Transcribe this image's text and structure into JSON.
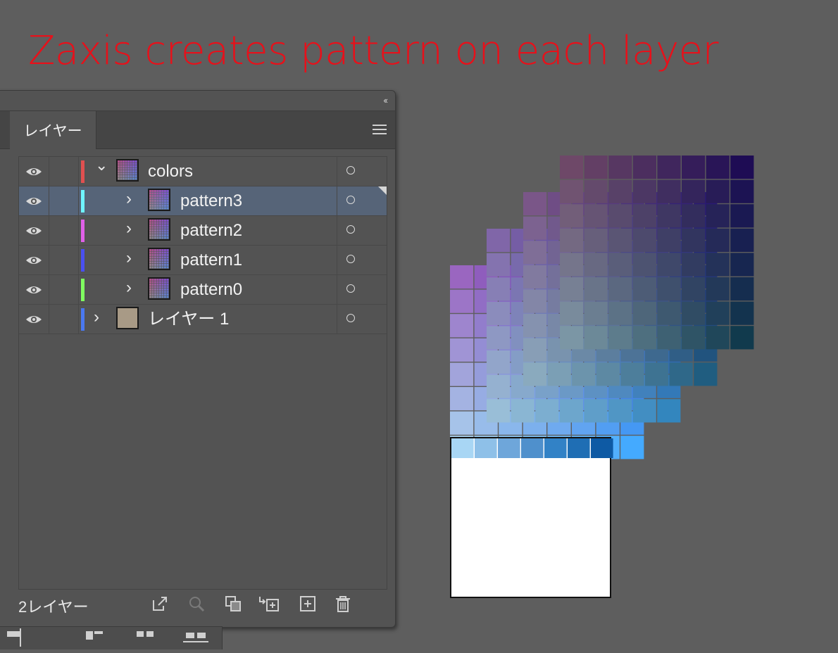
{
  "caption": {
    "text": "Zaxis creates pattern on each layer",
    "color": "#e8101a"
  },
  "layers_panel": {
    "collapse_glyph": "‹‹",
    "tab_label": "レイヤー",
    "rows": [
      {
        "name": "colors",
        "expanded": true,
        "color": "#e05050",
        "selected": false
      },
      {
        "name": "pattern3",
        "expanded": false,
        "color": "#6ff4ff",
        "selected": true
      },
      {
        "name": "pattern2",
        "expanded": false,
        "color": "#e060e8",
        "selected": false
      },
      {
        "name": "pattern1",
        "expanded": false,
        "color": "#4a50f0",
        "selected": false
      },
      {
        "name": "pattern0",
        "expanded": false,
        "color": "#80ff60",
        "selected": false
      },
      {
        "name": "レイヤー 1",
        "expanded": false,
        "color": "#4a78f0",
        "selected": false
      }
    ],
    "footer_count": "2レイヤー",
    "footer_icons": [
      "export-icon",
      "search-icon",
      "clip-mask-icon",
      "move-to-layer-icon",
      "new-sublayer-icon",
      "trash-icon"
    ]
  },
  "layer1_thumb_color": "#a89a86",
  "swatch_layers": [
    {
      "base_color": "#9a66c0",
      "corner_color": "#44aaff"
    },
    {
      "base_color": "#8066a8",
      "corner_color": "#3a98d8"
    },
    {
      "base_color": "#7a5688",
      "corner_color": "#2a7aa8"
    },
    {
      "base_color": "#6e4868",
      "corner_color": "#1a5a78"
    }
  ]
}
